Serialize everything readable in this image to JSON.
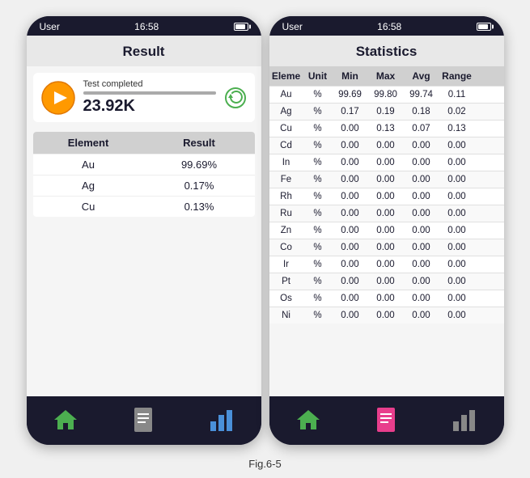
{
  "left_phone": {
    "status_bar": {
      "user": "User",
      "time": "16:58"
    },
    "title": "Result",
    "test_status": "Test completed",
    "result_value": "23.92K",
    "table_headers": [
      "Element",
      "Result"
    ],
    "table_rows": [
      {
        "element": "Au",
        "result": "99.69%"
      },
      {
        "element": "Ag",
        "result": "0.17%"
      },
      {
        "element": "Cu",
        "result": "0.13%"
      }
    ],
    "nav": {
      "home_label": "home",
      "doc_label": "document",
      "chart_label": "chart"
    }
  },
  "right_phone": {
    "status_bar": {
      "user": "User",
      "time": "16:58"
    },
    "title": "Statistics",
    "table_headers": [
      "Eleme",
      "Unit",
      "Min",
      "Max",
      "Avg",
      "Range"
    ],
    "table_rows": [
      {
        "elem": "Au",
        "unit": "%",
        "min": "99.69",
        "max": "99.80",
        "avg": "99.74",
        "range": "0.11"
      },
      {
        "elem": "Ag",
        "unit": "%",
        "min": "0.17",
        "max": "0.19",
        "avg": "0.18",
        "range": "0.02"
      },
      {
        "elem": "Cu",
        "unit": "%",
        "min": "0.00",
        "max": "0.13",
        "avg": "0.07",
        "range": "0.13"
      },
      {
        "elem": "Cd",
        "unit": "%",
        "min": "0.00",
        "max": "0.00",
        "avg": "0.00",
        "range": "0.00"
      },
      {
        "elem": "In",
        "unit": "%",
        "min": "0.00",
        "max": "0.00",
        "avg": "0.00",
        "range": "0.00"
      },
      {
        "elem": "Fe",
        "unit": "%",
        "min": "0.00",
        "max": "0.00",
        "avg": "0.00",
        "range": "0.00"
      },
      {
        "elem": "Rh",
        "unit": "%",
        "min": "0.00",
        "max": "0.00",
        "avg": "0.00",
        "range": "0.00"
      },
      {
        "elem": "Ru",
        "unit": "%",
        "min": "0.00",
        "max": "0.00",
        "avg": "0.00",
        "range": "0.00"
      },
      {
        "elem": "Zn",
        "unit": "%",
        "min": "0.00",
        "max": "0.00",
        "avg": "0.00",
        "range": "0.00"
      },
      {
        "elem": "Co",
        "unit": "%",
        "min": "0.00",
        "max": "0.00",
        "avg": "0.00",
        "range": "0.00"
      },
      {
        "elem": "Ir",
        "unit": "%",
        "min": "0.00",
        "max": "0.00",
        "avg": "0.00",
        "range": "0.00"
      },
      {
        "elem": "Pt",
        "unit": "%",
        "min": "0.00",
        "max": "0.00",
        "avg": "0.00",
        "range": "0.00"
      },
      {
        "elem": "Os",
        "unit": "%",
        "min": "0.00",
        "max": "0.00",
        "avg": "0.00",
        "range": "0.00"
      },
      {
        "elem": "Ni",
        "unit": "%",
        "min": "0.00",
        "max": "0.00",
        "avg": "0.00",
        "range": "0.00"
      }
    ],
    "nav": {
      "home_label": "home",
      "doc_label": "document",
      "chart_label": "chart"
    }
  },
  "caption": "Fig.6-5"
}
